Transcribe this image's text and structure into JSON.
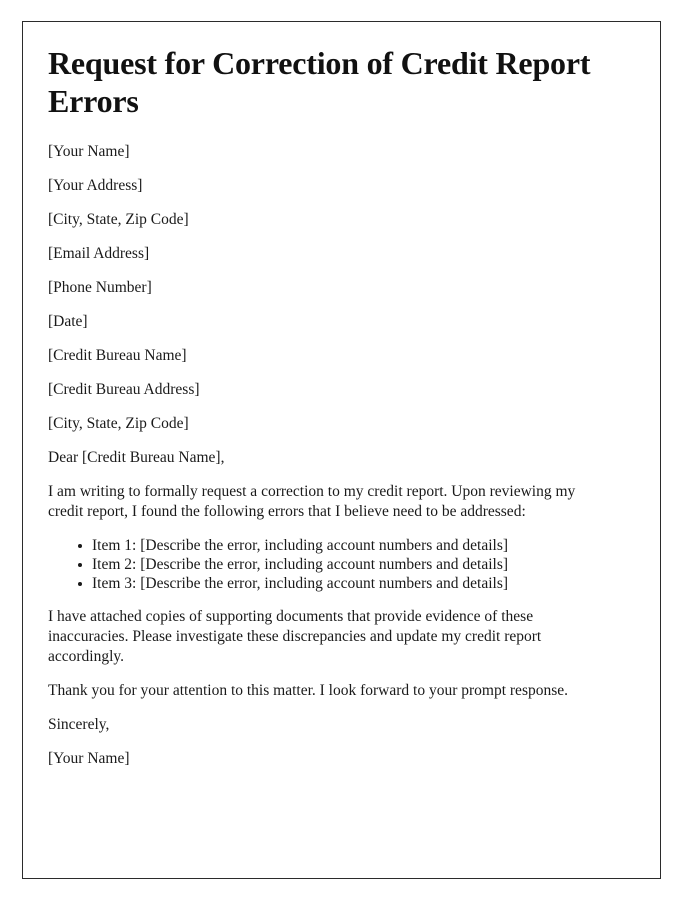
{
  "document": {
    "title": "Request for Correction of Credit Report Errors",
    "sender_block": [
      "[Your Name]",
      "[Your Address]",
      "[City, State, Zip Code]",
      "[Email Address]",
      "[Phone Number]"
    ],
    "date_line": "[Date]",
    "recipient_block": [
      "[Credit Bureau Name]",
      "[Credit Bureau Address]",
      "[City, State, Zip Code]"
    ],
    "salutation": "Dear [Credit Bureau Name],",
    "intro_paragraph": "I am writing to formally request a correction to my credit report. Upon reviewing my credit report, I found the following errors that I believe need to be addressed:",
    "error_items": [
      "Item 1: [Describe the error, including account numbers and details]",
      "Item 2: [Describe the error, including account numbers and details]",
      "Item 3: [Describe the error, including account numbers and details]"
    ],
    "attachments_paragraph": "I have attached copies of supporting documents that provide evidence of these inaccuracies. Please investigate these discrepancies and update my credit report accordingly.",
    "closing_paragraph": "Thank you for your attention to this matter. I look forward to your prompt response.",
    "sign_off": "Sincerely,",
    "signature_name": "[Your Name]"
  },
  "style": {
    "border_color": "#2b2b2b",
    "text_color": "#1a1a1a",
    "page_background": "#ffffff"
  }
}
